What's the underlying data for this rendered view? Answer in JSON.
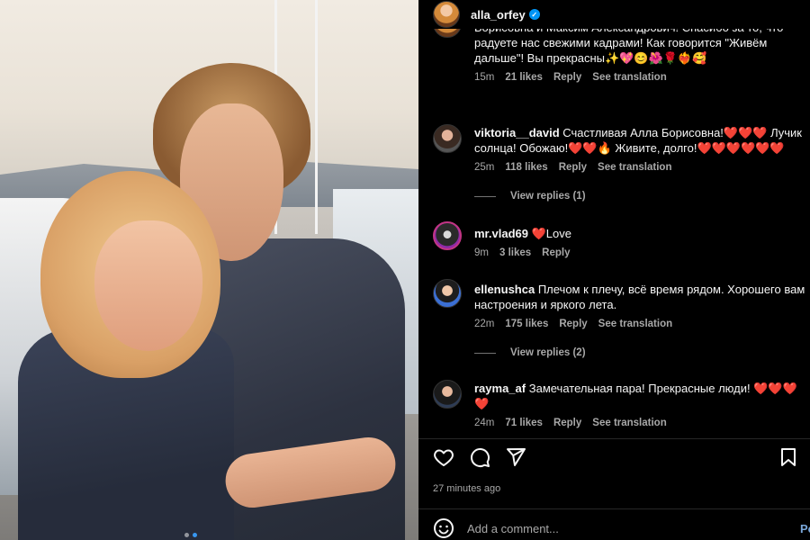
{
  "header": {
    "username": "alla_orfey",
    "verified_icon": "verified-badge-icon"
  },
  "comments": [
    {
      "username": "",
      "text": "Борисовна и Максим Александрович! Спасибо за то, что радуете нас свежими кадрами! Как говорится \"Живём дальше\"! Вы прекрасны✨💖😊🌺🌹❤️‍🔥🥰",
      "time": "15m",
      "likes": "21 likes",
      "reply": "Reply",
      "translation": "See translation"
    },
    {
      "username": "viktoria__david",
      "text": "Счастливая Алла Борисовна!❤️❤️❤️ Лучик солнца! Обожаю!❤️❤️🔥 Живите, долго!❤️❤️❤️❤️❤️❤️",
      "time": "25m",
      "likes": "118 likes",
      "reply": "Reply",
      "translation": "See translation",
      "view_replies": "View replies (1)"
    },
    {
      "username": "mr.vlad69",
      "text": "❤️Love",
      "time": "9m",
      "likes": "3 likes",
      "reply": "Reply"
    },
    {
      "username": "ellenushca",
      "text": "Плечом к плечу, всё время рядом. Хорошего вам настроения и яркого лета.",
      "time": "22m",
      "likes": "175 likes",
      "reply": "Reply",
      "translation": "See translation",
      "view_replies": "View replies (2)"
    },
    {
      "username": "rayma_af",
      "text": "Замечательная пара! Прекрасные люди! ❤️❤️❤️❤️",
      "time": "24m",
      "likes": "71 likes",
      "reply": "Reply",
      "translation": "See translation"
    }
  ],
  "actions": {
    "like_icon": "heart-icon",
    "comment_icon": "comment-icon",
    "share_icon": "share-icon",
    "save_icon": "bookmark-icon"
  },
  "post_time": "27 minutes ago",
  "add_comment": {
    "placeholder": "Add a comment...",
    "post_label": "Po"
  },
  "colors": {
    "background": "#000000",
    "text": "#f5f5f5",
    "muted": "#a8a8a8",
    "accent": "#0095f6"
  }
}
